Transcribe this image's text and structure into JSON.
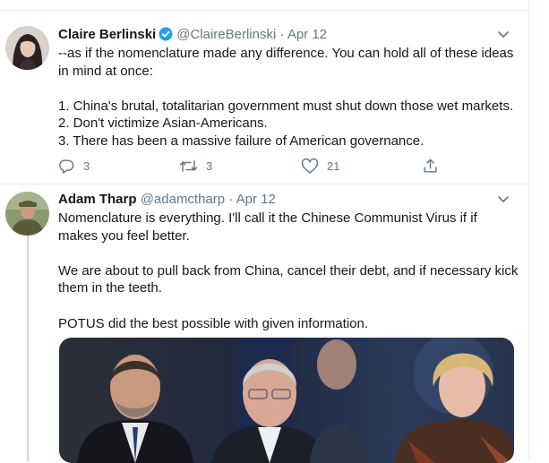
{
  "tweets": [
    {
      "name": "Claire Berlinski",
      "handle": "@ClaireBerlinski",
      "separator": "·",
      "date": "Apr 12",
      "verified": true,
      "avatar_icon": "avatar-woman",
      "text_lines": [
        "--as if the nomenclature made any difference. You can hold all of these ideas",
        "in mind at once:",
        "",
        "1. China's brutal, totalitarian government must shut down those wet markets.",
        "2. Don't victimize Asian-Americans.",
        "3. There has been a massive failure of American governance."
      ],
      "actions": {
        "reply_count": "3",
        "retweet_count": "3",
        "like_count": "21"
      }
    },
    {
      "name": "Adam Tharp",
      "handle": "@adamctharp",
      "separator": "·",
      "date": "Apr 12",
      "verified": false,
      "avatar_icon": "avatar-man-outdoors",
      "text_lines": [
        "Nomenclature is everything.  I'll call it the Chinese Communist Virus if if",
        "makes you feel better.",
        "",
        "We are about to pull back from China, cancel their debt, and if necessary kick",
        "them in the teeth.",
        "",
        "POTUS did the best possible with given information."
      ],
      "media_description_icon": "press-briefing-photo"
    }
  ],
  "colors": {
    "accent": "#1da1f2",
    "secondary_text": "#657786",
    "border": "#e6ecf0"
  }
}
